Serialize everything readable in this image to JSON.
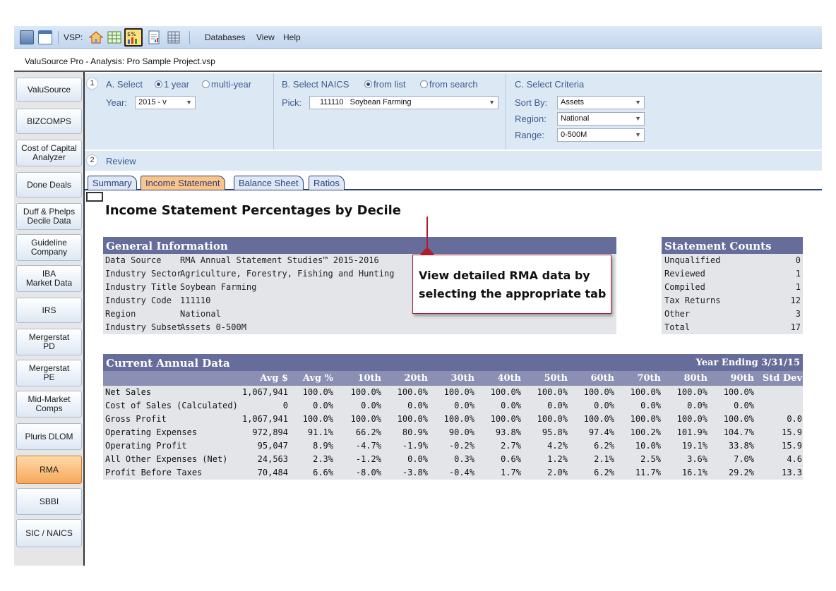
{
  "toolbar": {
    "vsp_label": "VSP:",
    "menus": [
      "Databases",
      "View",
      "Help"
    ],
    "icons": [
      "save-icon",
      "window-icon",
      "home-icon",
      "spreadsheet-icon",
      "valuation-chart-icon",
      "report-icon",
      "calculator-icon"
    ]
  },
  "window_title": "ValuSource Pro - Analysis: Pro Sample Project.vsp",
  "sidebar": {
    "items": [
      {
        "label": "ValuSource"
      },
      {
        "label": "BIZCOMPS"
      },
      {
        "label": "Cost of Capital\nAnalyzer"
      },
      {
        "label": "Done Deals"
      },
      {
        "label": "Duff & Phelps\nDecile Data"
      },
      {
        "label": "Guideline\nCompany"
      },
      {
        "label": "IBA\nMarket Data"
      },
      {
        "label": "IRS"
      },
      {
        "label": "Mergerstat\nPD"
      },
      {
        "label": "Mergerstat\nPE"
      },
      {
        "label": "Mid-Market\nComps"
      },
      {
        "label": "Pluris DLOM"
      },
      {
        "label": "RMA"
      },
      {
        "label": "SBBI"
      },
      {
        "label": "SIC / NAICS"
      }
    ],
    "active": "RMA"
  },
  "panel": {
    "step1": "1",
    "step2": "2",
    "a_label": "A. Select",
    "a_opt1": "1 year",
    "a_opt2": "multi-year",
    "year_label": "Year:",
    "year_value": "2015 - v",
    "b_label": "B. Select NAICS",
    "b_opt1": "from list",
    "b_opt2": "from search",
    "pick_label": "Pick:",
    "pick_value": "111110   Soybean Farming",
    "c_label": "C. Select Criteria",
    "sort_label": "Sort By:",
    "sort_value": "Assets",
    "region_label": "Region:",
    "region_value": "National",
    "range_label": "Range:",
    "range_value": "0-500M",
    "review_label": "Review"
  },
  "tabs": [
    "Summary",
    "Income Statement",
    "Balance Sheet",
    "Ratios"
  ],
  "active_tab": "Income Statement",
  "page_title": "Income Statement Percentages by Decile",
  "general_info": {
    "title": "General Information",
    "rows": [
      {
        "key": "Data Source",
        "value": "RMA Annual Statement Studies™ 2015-2016"
      },
      {
        "key": "Industry Sector",
        "value": "Agriculture, Forestry, Fishing and Hunting"
      },
      {
        "key": "Industry Title",
        "value": "Soybean Farming"
      },
      {
        "key": "Industry Code",
        "value": "111110"
      },
      {
        "key": "Region",
        "value": "National"
      },
      {
        "key": "Industry Subset",
        "value": "Assets 0-500M"
      }
    ]
  },
  "callout": {
    "line1": "View detailed RMA data by",
    "line2": "selecting the appropriate tab"
  },
  "statement_counts": {
    "title": "Statement Counts",
    "rows": [
      {
        "key": "Unqualified",
        "value": "0"
      },
      {
        "key": "Reviewed",
        "value": "1"
      },
      {
        "key": "Compiled",
        "value": "1"
      },
      {
        "key": "Tax Returns",
        "value": "12"
      },
      {
        "key": "Other",
        "value": "3"
      },
      {
        "key": "Total",
        "value": "17"
      }
    ]
  },
  "annual": {
    "title": "Current Annual Data",
    "year_ending": "Year Ending 3/31/15",
    "columns": [
      "Avg $",
      "Avg %",
      "10th",
      "20th",
      "30th",
      "40th",
      "50th",
      "60th",
      "70th",
      "80th",
      "90th",
      "Std Dev"
    ],
    "rows": [
      {
        "label": "Net Sales",
        "values": [
          "1,067,941",
          "100.0%",
          "100.0%",
          "100.0%",
          "100.0%",
          "100.0%",
          "100.0%",
          "100.0%",
          "100.0%",
          "100.0%",
          "100.0%",
          ""
        ]
      },
      {
        "label": "Cost of Sales (Calculated)",
        "values": [
          "0",
          "0.0%",
          "0.0%",
          "0.0%",
          "0.0%",
          "0.0%",
          "0.0%",
          "0.0%",
          "0.0%",
          "0.0%",
          "0.0%",
          ""
        ]
      },
      {
        "label": "Gross Profit",
        "values": [
          "1,067,941",
          "100.0%",
          "100.0%",
          "100.0%",
          "100.0%",
          "100.0%",
          "100.0%",
          "100.0%",
          "100.0%",
          "100.0%",
          "100.0%",
          "0.0"
        ]
      },
      {
        "label": "Operating Expenses",
        "values": [
          "972,894",
          "91.1%",
          "66.2%",
          "80.9%",
          "90.0%",
          "93.8%",
          "95.8%",
          "97.4%",
          "100.2%",
          "101.9%",
          "104.7%",
          "15.9"
        ]
      },
      {
        "label": "Operating Profit",
        "values": [
          "95,047",
          "8.9%",
          "-4.7%",
          "-1.9%",
          "-0.2%",
          "2.7%",
          "4.2%",
          "6.2%",
          "10.0%",
          "19.1%",
          "33.8%",
          "15.9"
        ]
      },
      {
        "label": "All Other Expenses (Net)",
        "values": [
          "24,563",
          "2.3%",
          "-1.2%",
          "0.0%",
          "0.3%",
          "0.6%",
          "1.2%",
          "2.1%",
          "2.5%",
          "3.6%",
          "7.0%",
          "4.6"
        ]
      },
      {
        "label": "Profit Before Taxes",
        "values": [
          "70,484",
          "6.6%",
          "-8.0%",
          "-3.8%",
          "-0.4%",
          "1.7%",
          "2.0%",
          "6.2%",
          "11.7%",
          "16.1%",
          "29.2%",
          "13.3"
        ]
      }
    ]
  },
  "colors": {
    "section_header": "#666d9a",
    "column_header": "#8a8fb3",
    "body_bg": "#e3e5e9",
    "active_tab": "#fbc48a",
    "callout_border": "#b01c2e"
  }
}
